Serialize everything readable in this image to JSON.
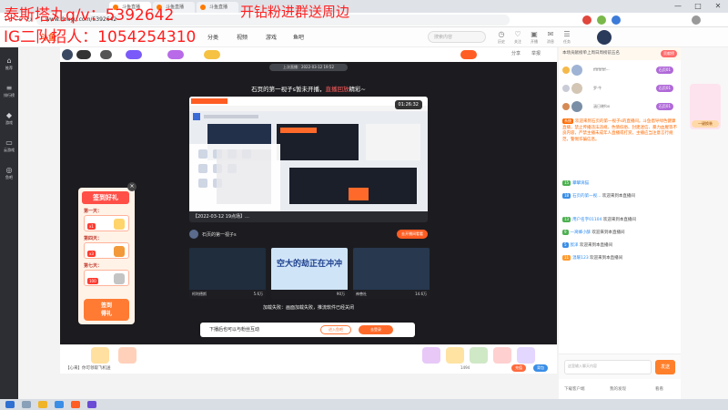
{
  "overlay": {
    "line1": "泰斯塔丸q/v：5392642",
    "line2": "IG二队招人：1054254310",
    "line3": "开钻粉进群送周边"
  },
  "browser": {
    "tabs": [
      "斗鱼直播",
      "斗鱼直播",
      "斗鱼直播"
    ],
    "url": "www.douyu.com/5392642",
    "win_min": "—",
    "win_max": "□",
    "win_close": "✕"
  },
  "site": {
    "logo": "斗鱼",
    "nav": [
      "分类",
      "视频",
      "游戏",
      "鱼吧"
    ],
    "search_placeholder": "搜索内容",
    "header_icons": [
      {
        "icon": "history-icon",
        "label": "历史"
      },
      {
        "icon": "follow-icon",
        "label": "关注"
      },
      {
        "icon": "gift-icon",
        "label": "开播"
      },
      {
        "icon": "message-icon",
        "label": "消息"
      },
      {
        "icon": "task-icon",
        "label": "任务"
      }
    ]
  },
  "rail": [
    {
      "icon": "home-icon",
      "label": "推荐"
    },
    {
      "icon": "list-icon",
      "label": "排行榜"
    },
    {
      "icon": "game-icon",
      "label": "游戏"
    },
    {
      "icon": "tv-icon",
      "label": "云游戏"
    },
    {
      "icon": "fish-icon",
      "label": "鱼吧"
    }
  ],
  "room": {
    "follow_count": "",
    "replay_pill": "上次直播：2022-03-12 19:52",
    "offline_title": "石页的第一视子s暂未开播，",
    "offline_link": "直播回放",
    "offline_suffix": "精彩~",
    "replay_caption": "【2022-03-12 19点场】…",
    "replay_time": "01:26:32",
    "streamer_name": "石页的第一视子s",
    "streamer_btn": "去开播间看看",
    "thumbs": [
      {
        "title": "柯利德斯",
        "views": "5.6万",
        "color": "#1f2d3d"
      },
      {
        "title": "空大的劫正在冲冲",
        "views": "90万",
        "color": "#cfe4f7"
      },
      {
        "title": "神兽社",
        "views": "14.6万",
        "color": "#27384f"
      }
    ],
    "load_fail": "加载失败：画面加载失败，推流软件已经关闭",
    "share": "分享",
    "report": "举报"
  },
  "login": {
    "text": "下播后也可以与粉丝互动",
    "btn1": "进入鱼吧",
    "btn2": "去登录"
  },
  "checkin": {
    "title": "签到好礼",
    "close": "×",
    "days": [
      {
        "label": "第一天：",
        "gift": "x1"
      },
      {
        "label": "第四天：",
        "gift": "x3"
      },
      {
        "label": "第七天：",
        "gift": "100"
      }
    ],
    "button": "签到\n得礼"
  },
  "giftbar": {
    "tip": "【心来】你可领取飞机送",
    "count1": "1494",
    "btn1": "充值",
    "btn2": "背包"
  },
  "rightcol": {
    "rank_title": "本场贡献榜单上周日周榜前五名",
    "rank_btn": "贡献榜",
    "ranks": [
      {
        "name": "ffffffffff···",
        "badge": "石页01",
        "color": "#f5b94b"
      },
      {
        "name": "罗·牛",
        "badge": "石页01",
        "color": "#c9ccd6"
      },
      {
        "name": "涵日晓fox",
        "badge": "石页01",
        "color": "#d58a54"
      }
    ],
    "messages": [
      {
        "lv": "系统",
        "color": "#ff6a00",
        "user": "",
        "text": "欢迎来到石页的第一视子s的直播间。斗鱼倡导绿色健康直播，禁止传播违法违规、色情低俗、封建迷信、暴力血腥等不良内容，严禁主播未成年人直播或打赏，主播应当注意言行规范，警惕诈骗信息。"
      },
      {
        "lv": "15",
        "color": "#4cb050",
        "user": "攀攀滴猫",
        "text": ""
      },
      {
        "lv": "18",
        "color": "#3a8ee6",
        "user": "石页的第一视...",
        "text": "欢迎来到本直播间"
      },
      {
        "lv": "13",
        "color": "#4cb050",
        "user": "用户名字01104",
        "text": "欢迎来到本直播间"
      },
      {
        "lv": "9",
        "color": "#4cb050",
        "user": "一窝蜂小酥",
        "text": "欢迎来到本直播间"
      },
      {
        "lv": "5",
        "color": "#3a8ee6",
        "user": "宸泽",
        "text": "欢迎来到本直播间"
      },
      {
        "lv": "11",
        "color": "#ff9a2e",
        "user": "温暖123",
        "text": "欢迎来到本直播间"
      }
    ],
    "input_placeholder": "这里输入聊天内容",
    "send": "发送",
    "bottom_left": "下载客户端",
    "bottom_mid": "我的发现",
    "bottom_right": "看看"
  },
  "ad": {
    "label": "一键换装"
  },
  "colors": {
    "brand": "#ff5d23",
    "accent": "#ff7f2a",
    "player_bg": "#1c1c20"
  }
}
